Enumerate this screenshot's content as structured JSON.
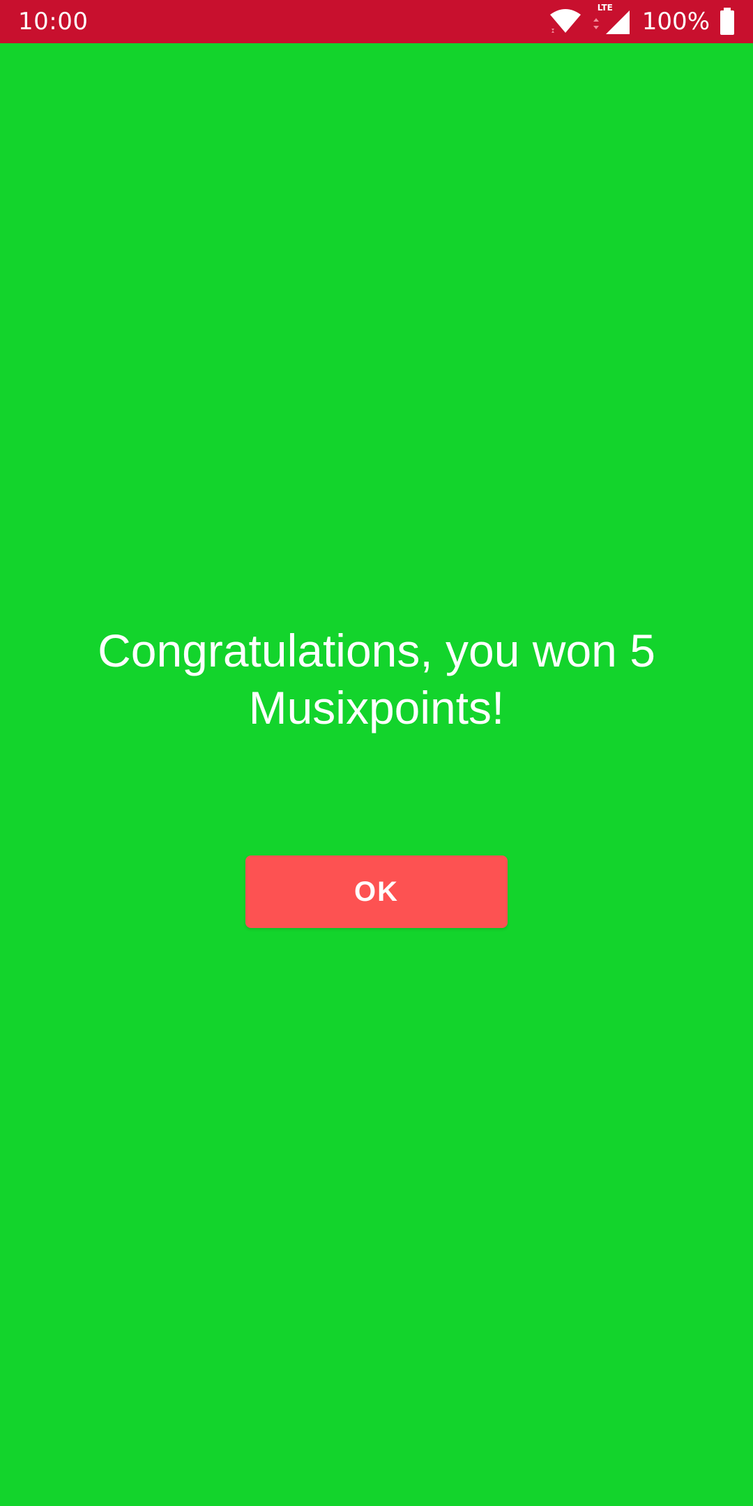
{
  "status_bar": {
    "time": "10:00",
    "network_label": "LTE",
    "battery": "100%",
    "background_color": "#c8102e",
    "icons": [
      "wifi-icon",
      "lte-signal-icon",
      "battery-icon"
    ]
  },
  "screen": {
    "background_color": "#13d42c"
  },
  "dialog": {
    "message": "Congratulations, you won 5 Musixpoints!",
    "ok_label": "OK",
    "ok_color": "#fd5252"
  }
}
